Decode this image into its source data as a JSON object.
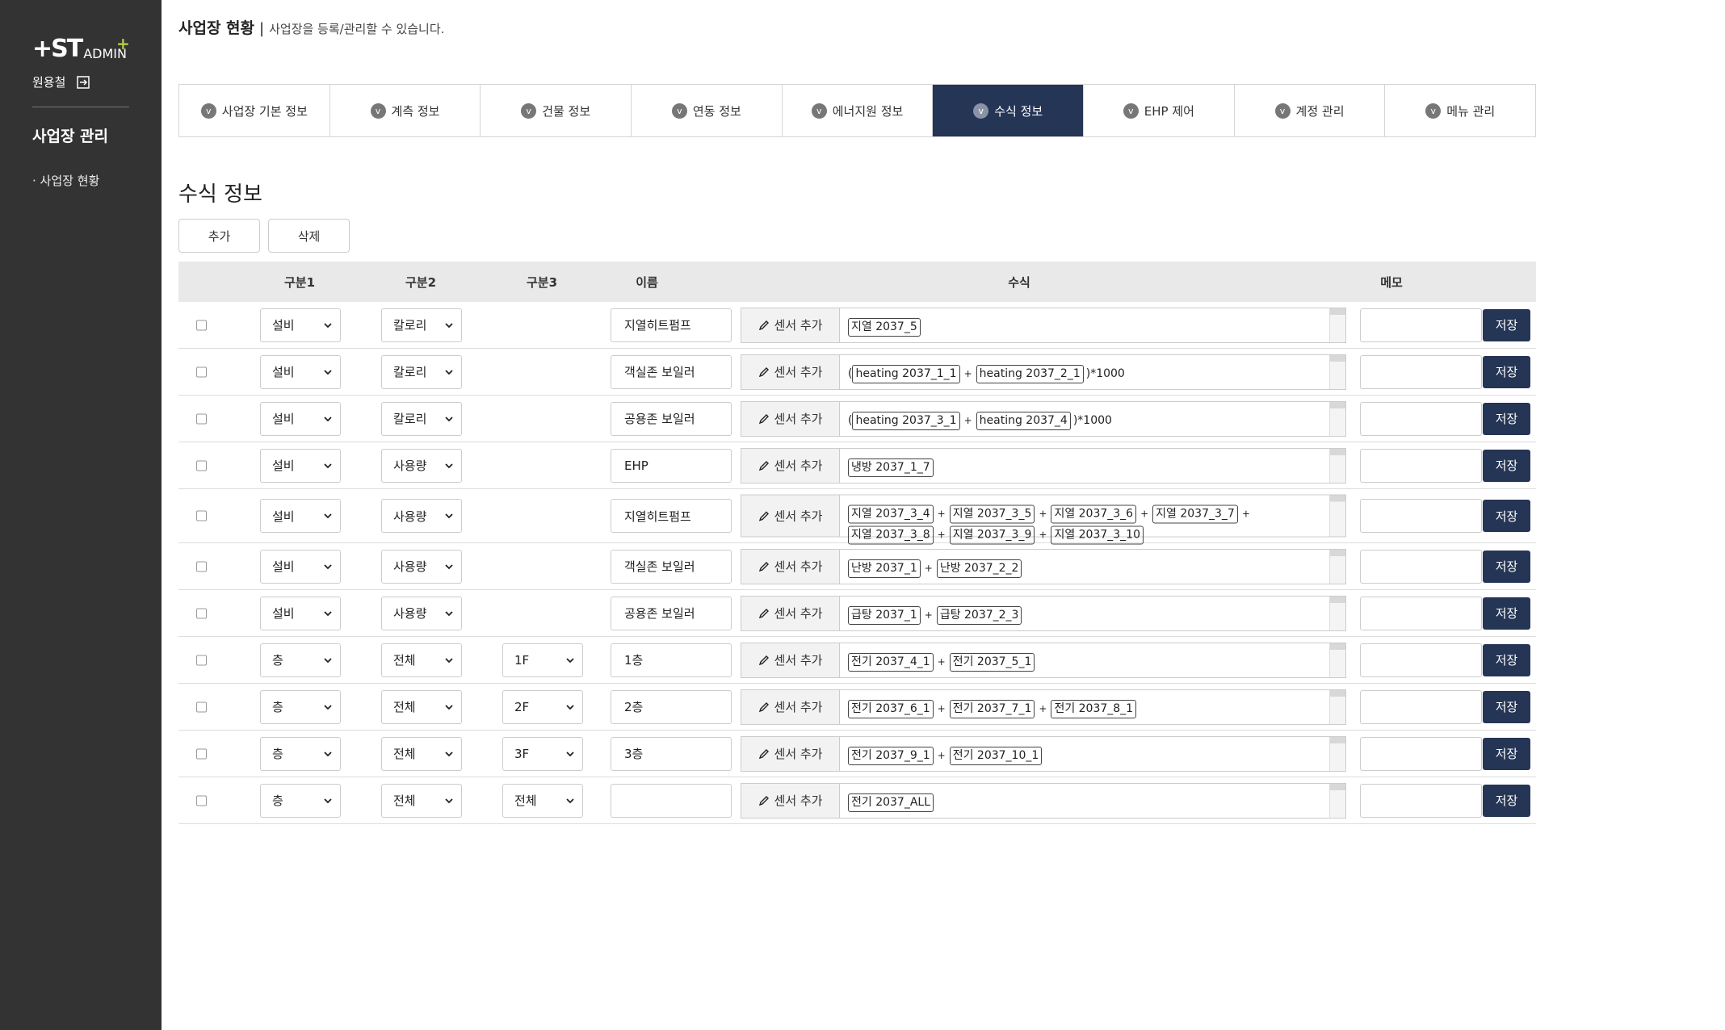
{
  "sidebar": {
    "logo_mark": "+ST",
    "logo_text": "ADMIN",
    "user": "원용철",
    "section": "사업장 관리",
    "items": [
      "· 사업장 현황"
    ]
  },
  "header": {
    "title": "사업장 현황",
    "separator": "|",
    "description": "사업장을 등록/관리할 수 있습니다."
  },
  "tabs": [
    {
      "badge": "v",
      "label": "사업장 기본 정보",
      "active": false
    },
    {
      "badge": "v",
      "label": "계측 정보",
      "active": false
    },
    {
      "badge": "v",
      "label": "건물 정보",
      "active": false
    },
    {
      "badge": "v",
      "label": "연동 정보",
      "active": false
    },
    {
      "badge": "v",
      "label": "에너지원 정보",
      "active": false
    },
    {
      "badge": "v",
      "label": "수식 정보",
      "active": true
    },
    {
      "badge": "v",
      "label": "EHP 제어",
      "active": false
    },
    {
      "badge": "v",
      "label": "계정 관리",
      "active": false
    },
    {
      "badge": "v",
      "label": "메뉴 관리",
      "active": false
    }
  ],
  "section_title": "수식 정보",
  "buttons": {
    "add": "추가",
    "delete": "삭제"
  },
  "columns": {
    "cat1": "구분1",
    "cat2": "구분2",
    "cat3": "구분3",
    "name": "이름",
    "formula": "수식",
    "memo": "메모"
  },
  "labels": {
    "add_sensor": "센서 추가",
    "save": "저장"
  },
  "rows": [
    {
      "cat1": "설비",
      "cat2": "칼로리",
      "cat3": "",
      "name": "지열히트펌프",
      "formula": "[지열 2037_5]"
    },
    {
      "cat1": "설비",
      "cat2": "칼로리",
      "cat3": "",
      "name": "객실존 보일러",
      "formula": "([heating 2037_1_1] + [heating 2037_2_1])*1000"
    },
    {
      "cat1": "설비",
      "cat2": "칼로리",
      "cat3": "",
      "name": "공용존 보일러",
      "formula": "([heating 2037_3_1] + [heating 2037_4])*1000"
    },
    {
      "cat1": "설비",
      "cat2": "사용량",
      "cat3": "",
      "name": "EHP",
      "formula": "[냉방 2037_1_7]"
    },
    {
      "cat1": "설비",
      "cat2": "사용량",
      "cat3": "",
      "name": "지열히트펌프",
      "formula": "[지열 2037_3_4] + [지열 2037_3_5] + [지열 2037_3_6] + [지열 2037_3_7] + [지열 2037_3_8] + [지열 2037_3_9] + [지열 2037_3_10]"
    },
    {
      "cat1": "설비",
      "cat2": "사용량",
      "cat3": "",
      "name": "객실존 보일러",
      "formula": "[난방 2037_1] + [난방 2037_2_2]"
    },
    {
      "cat1": "설비",
      "cat2": "사용량",
      "cat3": "",
      "name": "공용존 보일러",
      "formula": "[급탕 2037_1] + [급탕 2037_2_3]"
    },
    {
      "cat1": "층",
      "cat2": "전체",
      "cat3": "1F",
      "name": "1층",
      "formula": "[전기 2037_4_1] + [전기 2037_5_1]"
    },
    {
      "cat1": "층",
      "cat2": "전체",
      "cat3": "2F",
      "name": "2층",
      "formula": "[전기 2037_6_1] + [전기 2037_7_1] + [전기 2037_8_1]"
    },
    {
      "cat1": "층",
      "cat2": "전체",
      "cat3": "3F",
      "name": "3층",
      "formula": "[전기 2037_9_1] + [전기 2037_10_1]"
    },
    {
      "cat1": "층",
      "cat2": "전체",
      "cat3": "전체",
      "name": "",
      "formula": "[전기 2037_ALL]"
    }
  ]
}
